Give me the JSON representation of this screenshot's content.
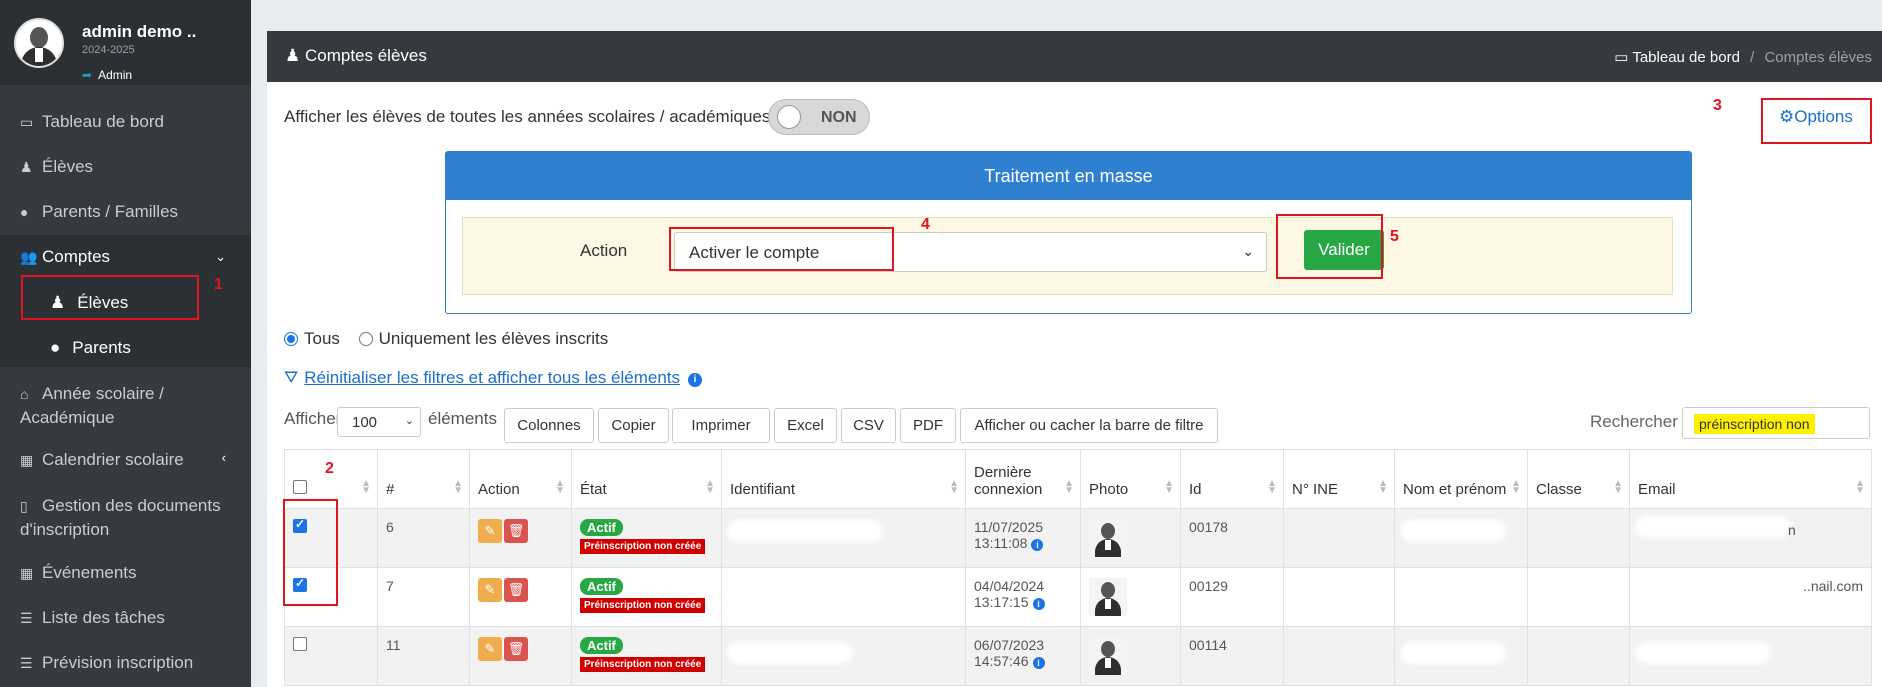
{
  "profile": {
    "name": "admin demo ..",
    "year": "2024-2025",
    "role": "Admin"
  },
  "sidebar": {
    "items": [
      {
        "label": "Tableau de bord",
        "icon": "laptop-icon"
      },
      {
        "label": "Élèves",
        "icon": "student-icon"
      },
      {
        "label": "Parents / Familles",
        "icon": "user-icon"
      },
      {
        "label": "Comptes",
        "icon": "users-icon"
      },
      {
        "label": "Élèves",
        "icon": "student-icon"
      },
      {
        "label": "Parents",
        "icon": "user-icon"
      },
      {
        "label": "Année scolaire /",
        "label2": "Académique",
        "icon": "home-icon"
      },
      {
        "label": "Calendrier scolaire",
        "icon": "calendar-icon"
      },
      {
        "label": "Gestion des documents",
        "label2": "d'inscription",
        "icon": "file-icon"
      },
      {
        "label": "Événements",
        "icon": "calendar-icon"
      },
      {
        "label": "Liste des tâches",
        "icon": "list-icon"
      },
      {
        "label": "Prévision inscription",
        "icon": "list-icon"
      }
    ]
  },
  "header": {
    "title": "Comptes élèves",
    "breadcrumb_home": "Tableau de bord",
    "breadcrumb_sep": "/",
    "breadcrumb_current": "Comptes élèves"
  },
  "toggle": {
    "label": "Afficher les élèves de toutes les années scolaires / académiques",
    "value": "NON"
  },
  "options_label": "Options",
  "mass": {
    "title": "Traitement en masse",
    "action_label": "Action",
    "selected": "Activer le compte",
    "submit": "Valider"
  },
  "radios": {
    "all": "Tous",
    "enrolled": "Uniquement les élèves inscrits"
  },
  "reset_link": "Réinitialiser les filtres et afficher tous les éléments",
  "length": {
    "before": "Afficher",
    "value": "100",
    "after": "éléments"
  },
  "buttons": [
    "Colonnes",
    "Copier",
    "Imprimer",
    "Excel",
    "CSV",
    "PDF",
    "Afficher ou cacher la barre de filtre"
  ],
  "search": {
    "label": "Rechercher :",
    "value": "préinscription non"
  },
  "table": {
    "headers": [
      "",
      "#",
      "Action",
      "État",
      "Identifiant",
      "Dernière",
      "Photo",
      "Id",
      "N° INE",
      "Nom et prénom",
      "Classe",
      "Email"
    ],
    "header_last_conn_line2": "connexion",
    "rows": [
      {
        "checked": true,
        "num": "6",
        "state": "Actif",
        "pre": "Préinscription non créée",
        "date": "11/07/2025",
        "time": "13:11:08",
        "id": "00178",
        "email_tail": "n"
      },
      {
        "checked": true,
        "num": "7",
        "state": "Actif",
        "pre": "Préinscription non créée",
        "date": "04/04/2024",
        "time": "13:17:15",
        "id": "00129",
        "email_tail": "..nail.com"
      },
      {
        "checked": false,
        "num": "11",
        "state": "Actif",
        "pre": "Préinscription non créée",
        "date": "06/07/2023",
        "time": "14:57:46",
        "id": "00114",
        "email_tail": ""
      }
    ]
  },
  "annotations": [
    "1",
    "2",
    "3",
    "4",
    "5"
  ],
  "colors": {
    "sidebar": "#343a40",
    "header": "#343a40",
    "primary": "#2f80d1",
    "success": "#28a745",
    "danger": "#d00000",
    "annotation": "#e0141e"
  }
}
